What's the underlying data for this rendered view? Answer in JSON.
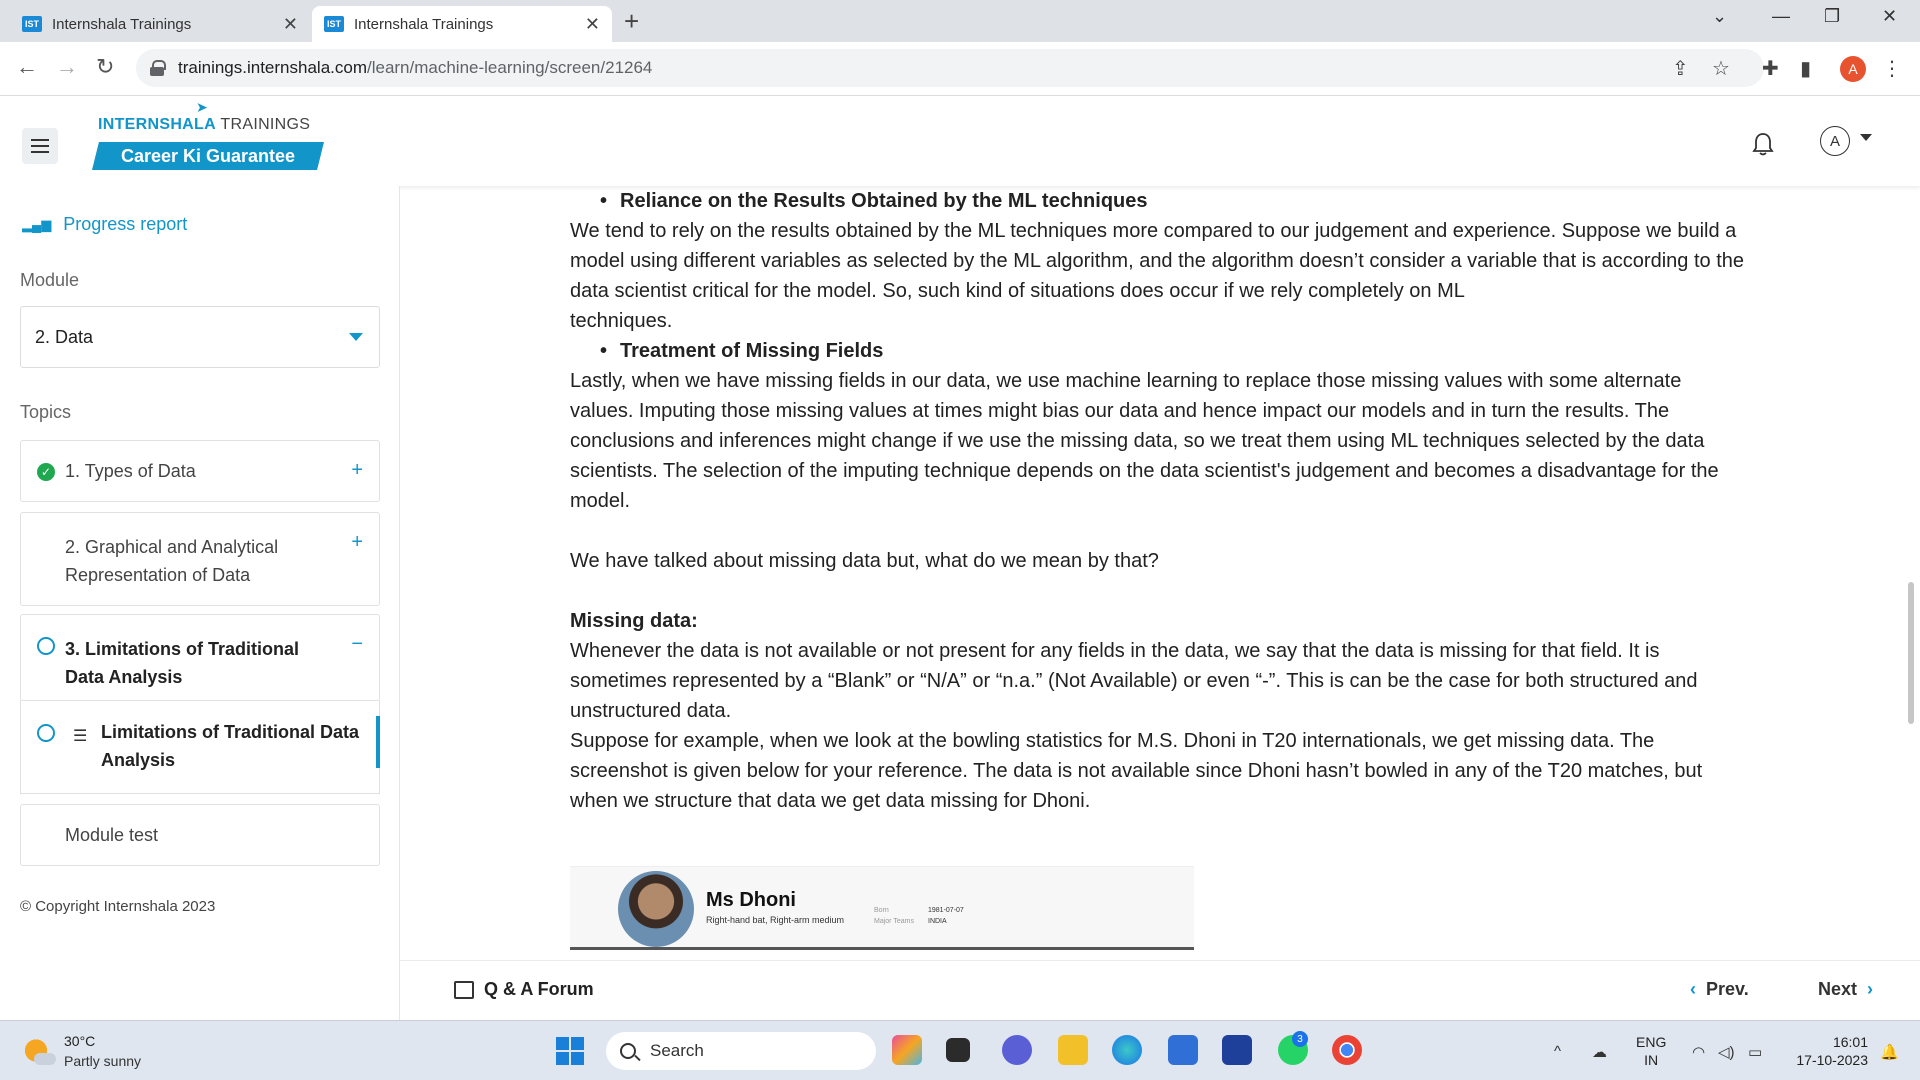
{
  "browser": {
    "tabs": [
      {
        "favicon": "IST",
        "title": "Internshala Trainings"
      },
      {
        "favicon": "IST",
        "title": "Internshala Trainings"
      }
    ],
    "url_host": "trainings.internshala.com",
    "url_path": "/learn/machine-learning/screen/21264",
    "profile_initial": "A"
  },
  "header": {
    "brand_bold": "INTERNSHALA",
    "brand_light": " TRAININGS",
    "tagline": "Career Ki Guarantee",
    "avatar_initial": "A"
  },
  "sidebar": {
    "progress_report": "Progress report",
    "module_label": "Module",
    "module_selected": "2. Data",
    "topics_label": "Topics",
    "topics": [
      {
        "label": "1. Types of Data",
        "status": "completed",
        "action": "+"
      },
      {
        "label": "2. Graphical and Analytical Representation of Data",
        "status": "none",
        "action": "+"
      },
      {
        "label": "3. Limitations of Traditional Data Analysis",
        "status": "in-progress",
        "action": "−"
      }
    ],
    "active_subtopic": "Limitations of Traditional Data Analysis",
    "module_test": "Module test",
    "copyright": "© Copyright Internshala 2023"
  },
  "article": {
    "bullet1": "Reliance on the Results Obtained by the ML techniques",
    "para1": "We tend to rely on the results obtained by the ML techniques more compared to our judgement and experience. Suppose we build a model using different variables as selected by the ML algorithm, and the algorithm doesn’t consider a variable that is according to the data scientist critical for the model. So, such kind of situations does occur if we rely completely on ML",
    "para1b": "techniques.",
    "bullet2": "Treatment of Missing Fields",
    "para2": "Lastly, when we have missing fields in our data, we use machine learning to replace those missing values with some alternate values. Imputing those missing values at times might bias our data and hence impact our models and in turn the results. The conclusions and inferences might change if we use the missing data, so we treat them using ML techniques selected by the data scientists. The selection of the imputing technique depends on the data scientist's judgement and becomes a disadvantage for the model.",
    "para3": "We have talked about missing data but, what do we mean by that?",
    "heading": "Missing data:",
    "para4": "Whenever the data is not available or not present for any fields in the data, we say that the data is missing for that field. It is sometimes represented by a “Blank” or “N/A” or “n.a.” (Not Available) or even “-”. This is can be the case for both structured and unstructured data.",
    "para5": "Suppose for example, when we look at the bowling statistics for M.S. Dhoni in T20 internationals, we get missing data. The screenshot is given below for your reference. The data is not available since Dhoni hasn’t bowled in any of the T20 matches, but when we structure that data we get data missing for Dhoni.",
    "figure": {
      "name": "Ms Dhoni",
      "role": "Right-hand bat, Right-arm medium",
      "born_label": "Born",
      "teams_label": "Major Teams",
      "born_value": "1981-07-07",
      "teams_value": "INDIA"
    }
  },
  "footer": {
    "qa": "Q & A Forum",
    "prev": "Prev.",
    "next": "Next"
  },
  "taskbar": {
    "temperature": "30°C",
    "weather": "Partly sunny",
    "search": "Search",
    "whatsapp_badge": "3",
    "lang_top": "ENG",
    "lang_bottom": "IN",
    "time": "16:01",
    "date": "17-10-2023"
  },
  "colors": {
    "accent": "#1295c9",
    "success": "#1fa84f"
  }
}
